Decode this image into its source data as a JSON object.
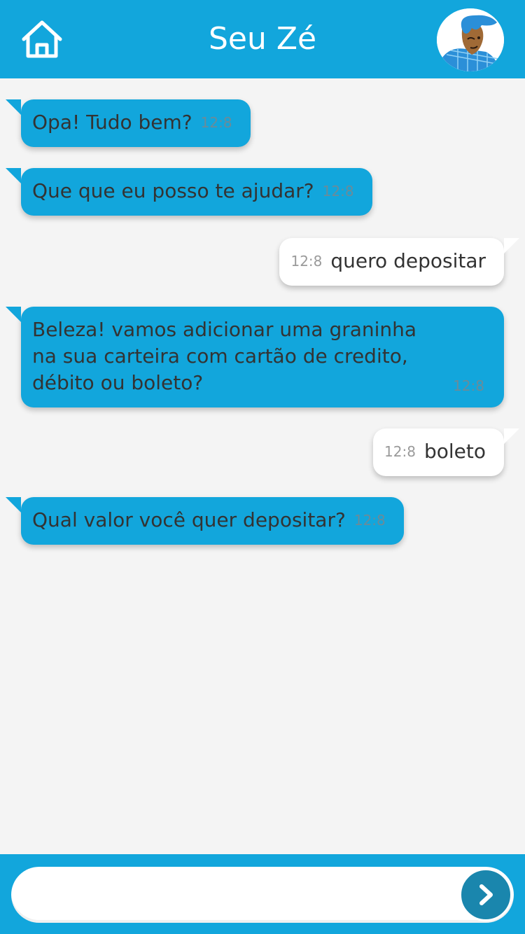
{
  "header": {
    "title": "Seu Zé",
    "home_icon": "home-icon",
    "avatar_icon": "avatar-illustration"
  },
  "messages": [
    {
      "sender": "bot",
      "text": "Opa! Tudo bem?",
      "time": "12:8"
    },
    {
      "sender": "bot",
      "text": "Que que eu posso te ajudar?",
      "time": "12:8"
    },
    {
      "sender": "user",
      "text": "quero depositar",
      "time": "12:8"
    },
    {
      "sender": "bot",
      "text": "Beleza! vamos adicionar uma graninha na sua carteira com cartão de credito, débito ou boleto?",
      "time": "12:8"
    },
    {
      "sender": "user",
      "text": "boleto",
      "time": "12:8"
    },
    {
      "sender": "bot",
      "text": "Qual valor você quer depositar?",
      "time": "12:8"
    }
  ],
  "composer": {
    "value": "",
    "placeholder": "",
    "send_icon": "chevron-right-icon"
  },
  "colors": {
    "primary": "#12a6dc",
    "send_button": "#1a86ad",
    "background": "#f4f4f4"
  }
}
